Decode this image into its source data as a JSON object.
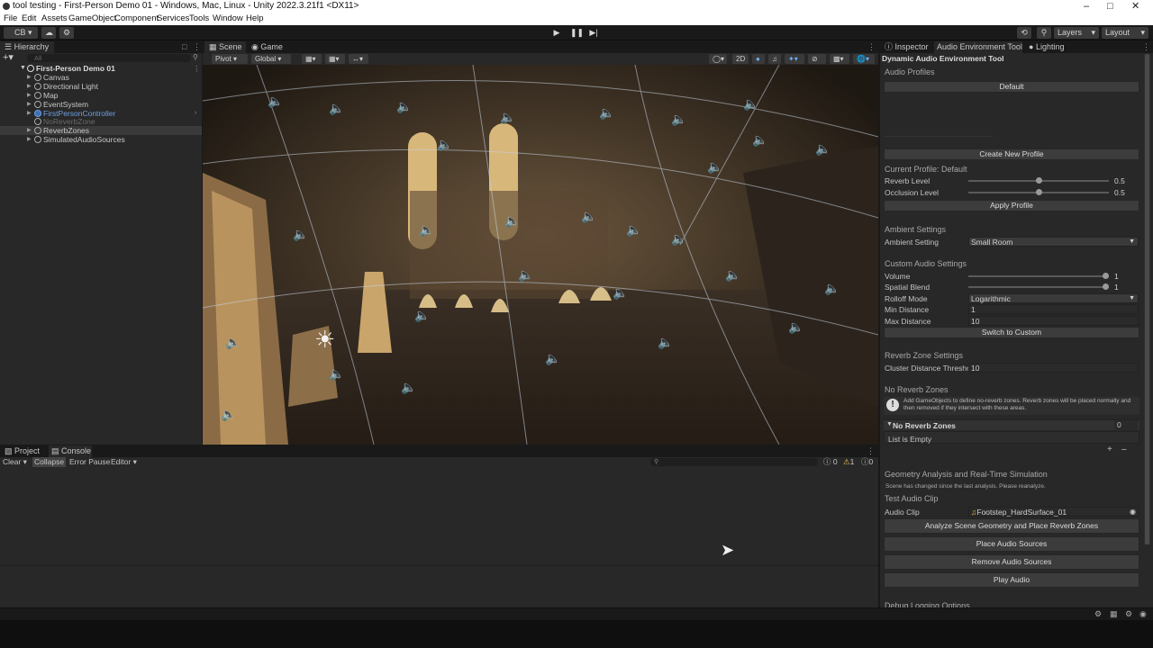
{
  "window": {
    "title": "tool testing - First-Person Demo 01 - Windows, Mac, Linux - Unity 2022.3.21f1 <DX11>"
  },
  "menu": [
    "File",
    "Edit",
    "Assets",
    "GameObject",
    "Component",
    "Services",
    "Tools",
    "Window",
    "Help"
  ],
  "toolbar": {
    "account": "CB",
    "layers": "Layers",
    "layout": "Layout"
  },
  "hierarchy": {
    "tab": "Hierarchy",
    "search_placeholder": "All",
    "scene": "First-Person Demo 01",
    "items": [
      {
        "label": "Canvas",
        "color": "#c8c8c8"
      },
      {
        "label": "Directional Light",
        "color": "#c8c8c8"
      },
      {
        "label": "Map",
        "color": "#c8c8c8"
      },
      {
        "label": "EventSystem",
        "color": "#c8c8c8"
      },
      {
        "label": "FirstPersonController",
        "color": "#6f9fe0"
      },
      {
        "label": "NoReverbZone",
        "color": "#6a6a6a"
      },
      {
        "label": "ReverbZones",
        "color": "#c8c8c8"
      },
      {
        "label": "SimulatedAudioSources",
        "color": "#c8c8c8"
      }
    ]
  },
  "scene_tabs": [
    "Scene",
    "Game"
  ],
  "scene_toolbar": {
    "pivot": "Pivot",
    "global": "Global",
    "mode2d": "2D"
  },
  "console": {
    "tabs": [
      "Project",
      "Console"
    ],
    "clear": "Clear",
    "collapse": "Collapse",
    "error_pause": "Error Pause",
    "editor": "Editor",
    "count_info": "0",
    "count_warn": "1",
    "count_error": "0"
  },
  "inspector": {
    "tabs": [
      "Inspector",
      "Audio Environment Tool",
      "Lighting"
    ],
    "title": "Dynamic Audio Environment Tool",
    "audio_profiles": "Audio Profiles",
    "default_btn": "Default",
    "create_btn": "Create New Profile",
    "current_profile": "Current Profile: Default",
    "reverb_level": "Reverb Level",
    "reverb_value": "0.5",
    "reverb_fraction": 0.5,
    "occlusion_level": "Occlusion Level",
    "occlusion_value": "0.5",
    "occlusion_fraction": 0.5,
    "apply_btn": "Apply Profile",
    "ambient_header": "Ambient Settings",
    "ambient_setting": "Ambient Setting",
    "ambient_value": "Small Room",
    "custom_header": "Custom Audio Settings",
    "volume": "Volume",
    "volume_value": "1",
    "volume_fraction": 1,
    "spatial": "Spatial Blend",
    "spatial_value": "1",
    "spatial_fraction": 1,
    "rolloff": "Rolloff Mode",
    "rolloff_value": "Logarithmic",
    "min_distance": "Min Distance",
    "min_value": "1",
    "max_distance": "Max Distance",
    "max_value": "10",
    "switch_btn": "Switch to Custom",
    "reverb_zone_header": "Reverb Zone Settings",
    "cluster": "Cluster Distance Threshol",
    "cluster_value": "10",
    "no_reverb_header": "No Reverb Zones",
    "info_text": "Add GameObjects to define no-reverb zones. Reverb zones will be placed normally and then removed if they intersect with these areas.",
    "list_title": "No Reverb Zones",
    "list_count": "0",
    "list_empty": "List is Empty",
    "geo_header": "Geometry Analysis and Real-Time Simulation",
    "geo_note": "Scene has changed since the last analysis. Please reanalyze.",
    "test_header": "Test Audio Clip",
    "audio_clip": "Audio Clip",
    "audio_clip_value": "Footstep_HardSurface_01",
    "analyze_btn": "Analyze Scene Geometry and Place Reverb Zones",
    "place_btn": "Place Audio Sources",
    "remove_btn": "Remove Audio Sources",
    "play_btn": "Play Audio",
    "debug_header": "Debug Logging Options"
  }
}
